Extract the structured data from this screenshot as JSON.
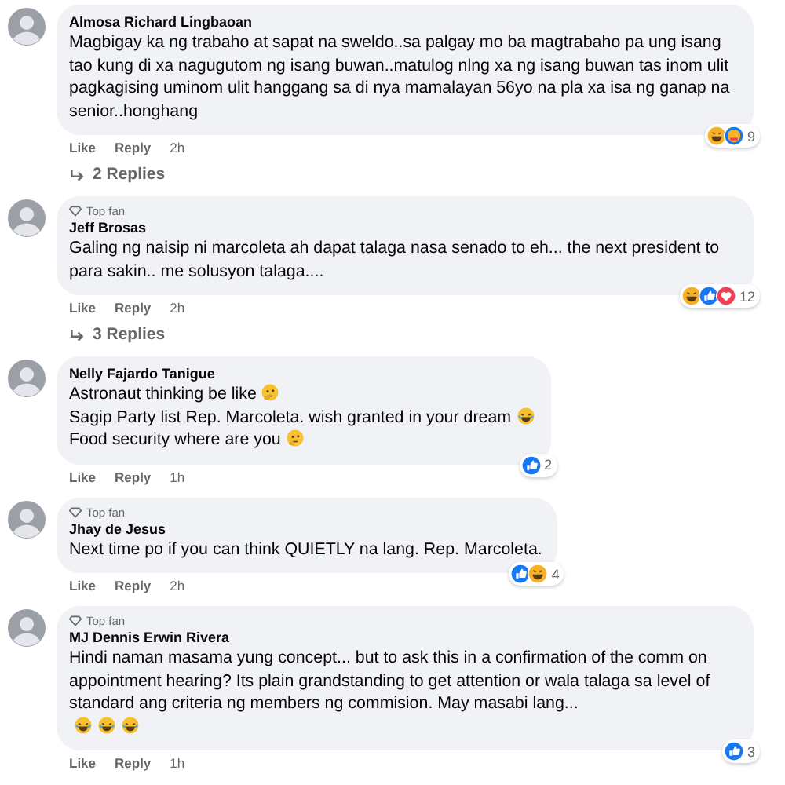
{
  "comments": [
    {
      "top_fan": false,
      "author": "Almosa Richard Lingbaoan",
      "body": [
        [
          {
            "kind": "text",
            "text": "Magbigay ka ng trabaho at sapat na sweldo..sa palgay mo ba magtrabaho pa ung isang tao kung di xa nagugutom ng isang buwan..matulog nlng xa ng isang buwan tas inom ulit pagkagising uminom ulit hanggang sa di nya mamalayan 56yo na pla xa isa ng ganap na senior..honghang"
          }
        ]
      ],
      "reactions": [
        {
          "kind": "haha"
        },
        {
          "kind": "care"
        }
      ],
      "reaction_count": "9",
      "actions": [
        "Like",
        "Reply"
      ],
      "time": "2h",
      "replies": "2 Replies"
    },
    {
      "top_fan": true,
      "top_fan_label": "Top fan",
      "author": "Jeff Brosas",
      "body": [
        [
          {
            "kind": "text",
            "text": "Galing ng naisip ni marcoleta ah dapat talaga nasa senado to eh... the next president to para sakin.. me solusyon talaga...."
          }
        ]
      ],
      "reactions": [
        {
          "kind": "haha"
        },
        {
          "kind": "like"
        },
        {
          "kind": "love"
        }
      ],
      "reaction_count": "12",
      "actions": [
        "Like",
        "Reply"
      ],
      "time": "2h",
      "replies": "3 Replies"
    },
    {
      "top_fan": false,
      "author": "Nelly Fajardo Tanigue",
      "body": [
        [
          {
            "kind": "text",
            "text": "Astronaut thinking be like"
          },
          {
            "kind": "thinking"
          }
        ],
        [
          {
            "kind": "text",
            "text": "Sagip Party list Rep. Marcoleta. wish granted in your dream"
          },
          {
            "kind": "laughing"
          }
        ],
        [
          {
            "kind": "text",
            "text": "Food security where are you"
          },
          {
            "kind": "thinking"
          }
        ]
      ],
      "reactions": [
        {
          "kind": "like"
        }
      ],
      "reaction_count": "2",
      "actions": [
        "Like",
        "Reply"
      ],
      "time": "1h"
    },
    {
      "top_fan": true,
      "top_fan_label": "Top fan",
      "author": "Jhay de Jesus",
      "body": [
        [
          {
            "kind": "text",
            "text": "Next time po if you can think QUIETLY na lang. Rep. Marcoleta."
          }
        ]
      ],
      "reactions": [
        {
          "kind": "like"
        },
        {
          "kind": "haha"
        }
      ],
      "reaction_count": "4",
      "actions": [
        "Like",
        "Reply"
      ],
      "time": "2h"
    },
    {
      "top_fan": true,
      "top_fan_label": "Top fan",
      "author": "MJ Dennis Erwin Rivera",
      "body": [
        [
          {
            "kind": "text",
            "text": "Hindi naman masama yung concept... but to ask this in a confirmation of the comm on appointment hearing? Its plain grandstanding to get attention or wala talaga sa level of standard ang criteria ng members ng commision. May masabi lang..."
          }
        ],
        [
          {
            "kind": "laughing"
          },
          {
            "kind": "laughing"
          },
          {
            "kind": "laughing"
          }
        ]
      ],
      "reactions": [
        {
          "kind": "like"
        }
      ],
      "reaction_count": "3",
      "actions": [
        "Like",
        "Reply"
      ],
      "time": "1h"
    }
  ]
}
